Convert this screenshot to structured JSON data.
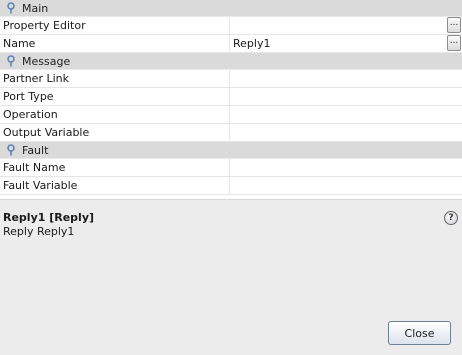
{
  "properties": {
    "main": {
      "label": "Main",
      "rows": [
        {
          "key": "Property Editor",
          "value": "",
          "editor_button": "..."
        },
        {
          "key": "Name",
          "value": "Reply1",
          "editor_button": "..."
        }
      ]
    },
    "message": {
      "label": "Message",
      "rows": [
        {
          "key": "Partner Link",
          "value": ""
        },
        {
          "key": "Port Type",
          "value": ""
        },
        {
          "key": "Operation",
          "value": ""
        },
        {
          "key": "Output Variable",
          "value": ""
        }
      ]
    },
    "fault": {
      "label": "Fault",
      "rows": [
        {
          "key": "Fault Name",
          "value": ""
        },
        {
          "key": "Fault Variable",
          "value": ""
        }
      ]
    }
  },
  "help": {
    "title": "Reply1 [Reply]",
    "description": "Reply Reply1",
    "icon": "?"
  },
  "footer": {
    "close_label": "Close"
  }
}
